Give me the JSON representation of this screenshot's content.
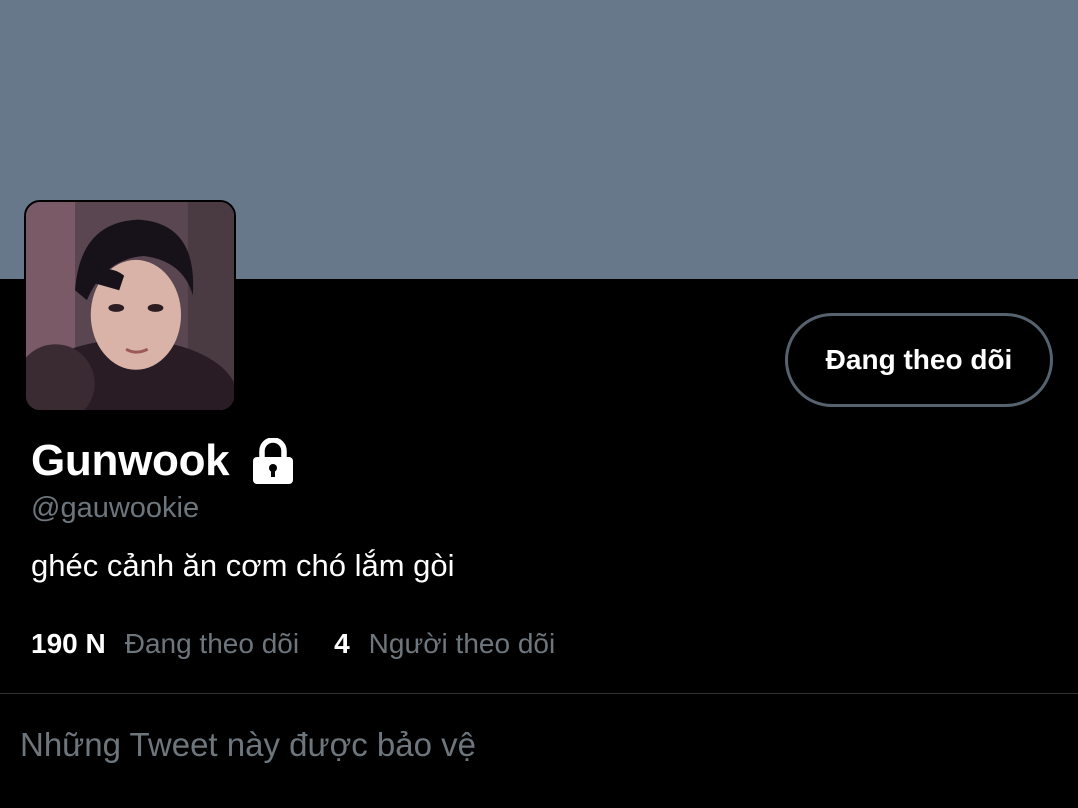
{
  "profile": {
    "display_name": "Gunwook",
    "handle": "@gauwookie",
    "bio": "ghéc cảnh ăn cơm chó lắm gòi",
    "avatar_icon": "avatar-photo",
    "protected_icon": "lock-icon"
  },
  "actions": {
    "follow_button_label": "Đang theo dõi"
  },
  "stats": {
    "following_count": "190 N",
    "following_label": "Đang theo dõi",
    "followers_count": "4",
    "followers_label": "Người theo dõi"
  },
  "tweets": {
    "protected_message": "Những Tweet này được bảo vệ"
  },
  "colors": {
    "banner": "#66788a",
    "background": "#000000",
    "secondary_text": "#6e767d",
    "button_border": "#56636f"
  }
}
